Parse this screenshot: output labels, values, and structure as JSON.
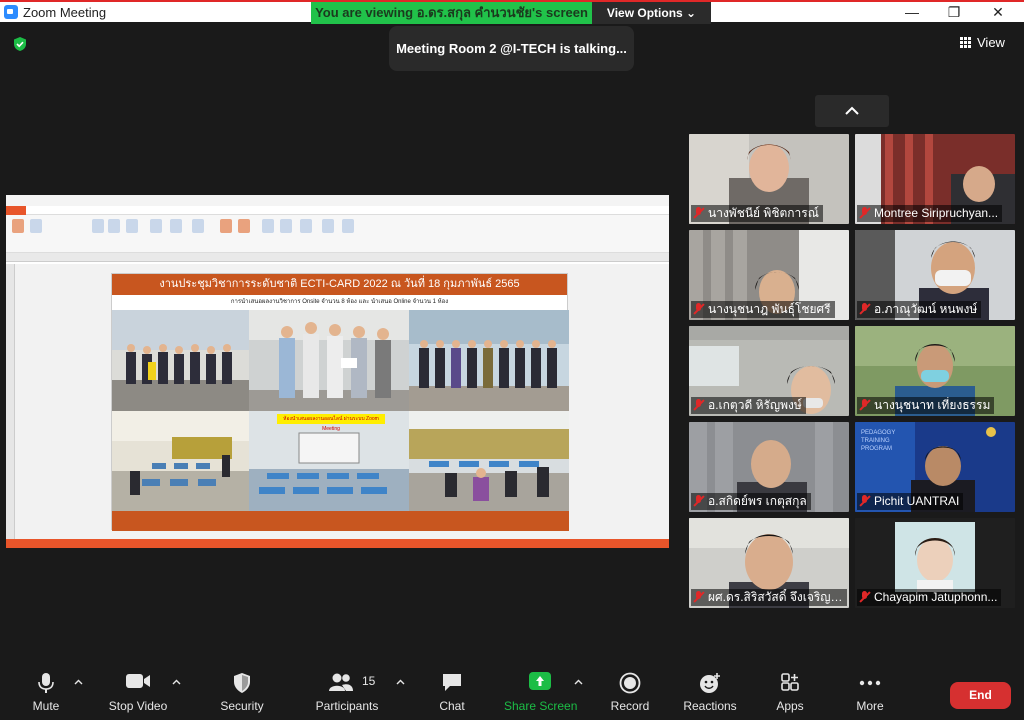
{
  "window": {
    "title": "Zoom Meeting",
    "minimize": "—",
    "maximize": "❐",
    "close": "✕"
  },
  "share_banner": {
    "text": "You are viewing อ.ดร.สกุล คำนวนชัย's screen",
    "view_options": "View Options ⌄"
  },
  "talking_indicator": "Meeting Room 2 @I-TECH is talking...",
  "view_button": "View",
  "shared_screen": {
    "slide_title": "งานประชุมวิชาการระดับชาติ ECTI-CARD 2022 ณ วันที่ 18 กุมภาพันธ์ 2565",
    "slide_subtitle": "การนำเสนอผลงานวิชาการ Onsite จำนวน 8 ห้อง และ นำเสนอ Online จำนวน 1 ห้อง",
    "zoom_tag": "ห้องนำเสนอผลงานออนไลน์ ผ่านระบบ Zoom Meeting"
  },
  "participants": [
    {
      "name": "นางพัชนีย์  พิชิตการณ์"
    },
    {
      "name": "Montree Siripruchyan..."
    },
    {
      "name": "นางนุชนาฎ  พันธุ์โชยศรี"
    },
    {
      "name": "อ.ภาณุวัฒน์  หนพงษ์"
    },
    {
      "name": "อ.เกตุวดี  หิรัญพงษ์"
    },
    {
      "name": "นางนุชนาท  เที่ยงธรรม"
    },
    {
      "name": "อ.สกิดย์พร  เกตุสกุล"
    },
    {
      "name": "Pichit UANTRAI"
    },
    {
      "name": "ผศ.ดร.สิริสวัสดิ์  จึงเจริญนิ..."
    },
    {
      "name": "Chayapim Jatuphonn..."
    }
  ],
  "toolbar": {
    "mute": "Mute",
    "stop_video": "Stop Video",
    "security": "Security",
    "participants": "Participants",
    "participant_count": "15",
    "chat": "Chat",
    "share_screen": "Share Screen",
    "record": "Record",
    "reactions": "Reactions",
    "apps": "Apps",
    "more": "More",
    "end": "End"
  },
  "colors": {
    "share_green": "#21c24a",
    "end_red": "#d63030",
    "slide_orange": "#c8561f",
    "nitro_orange": "#e8552a"
  }
}
